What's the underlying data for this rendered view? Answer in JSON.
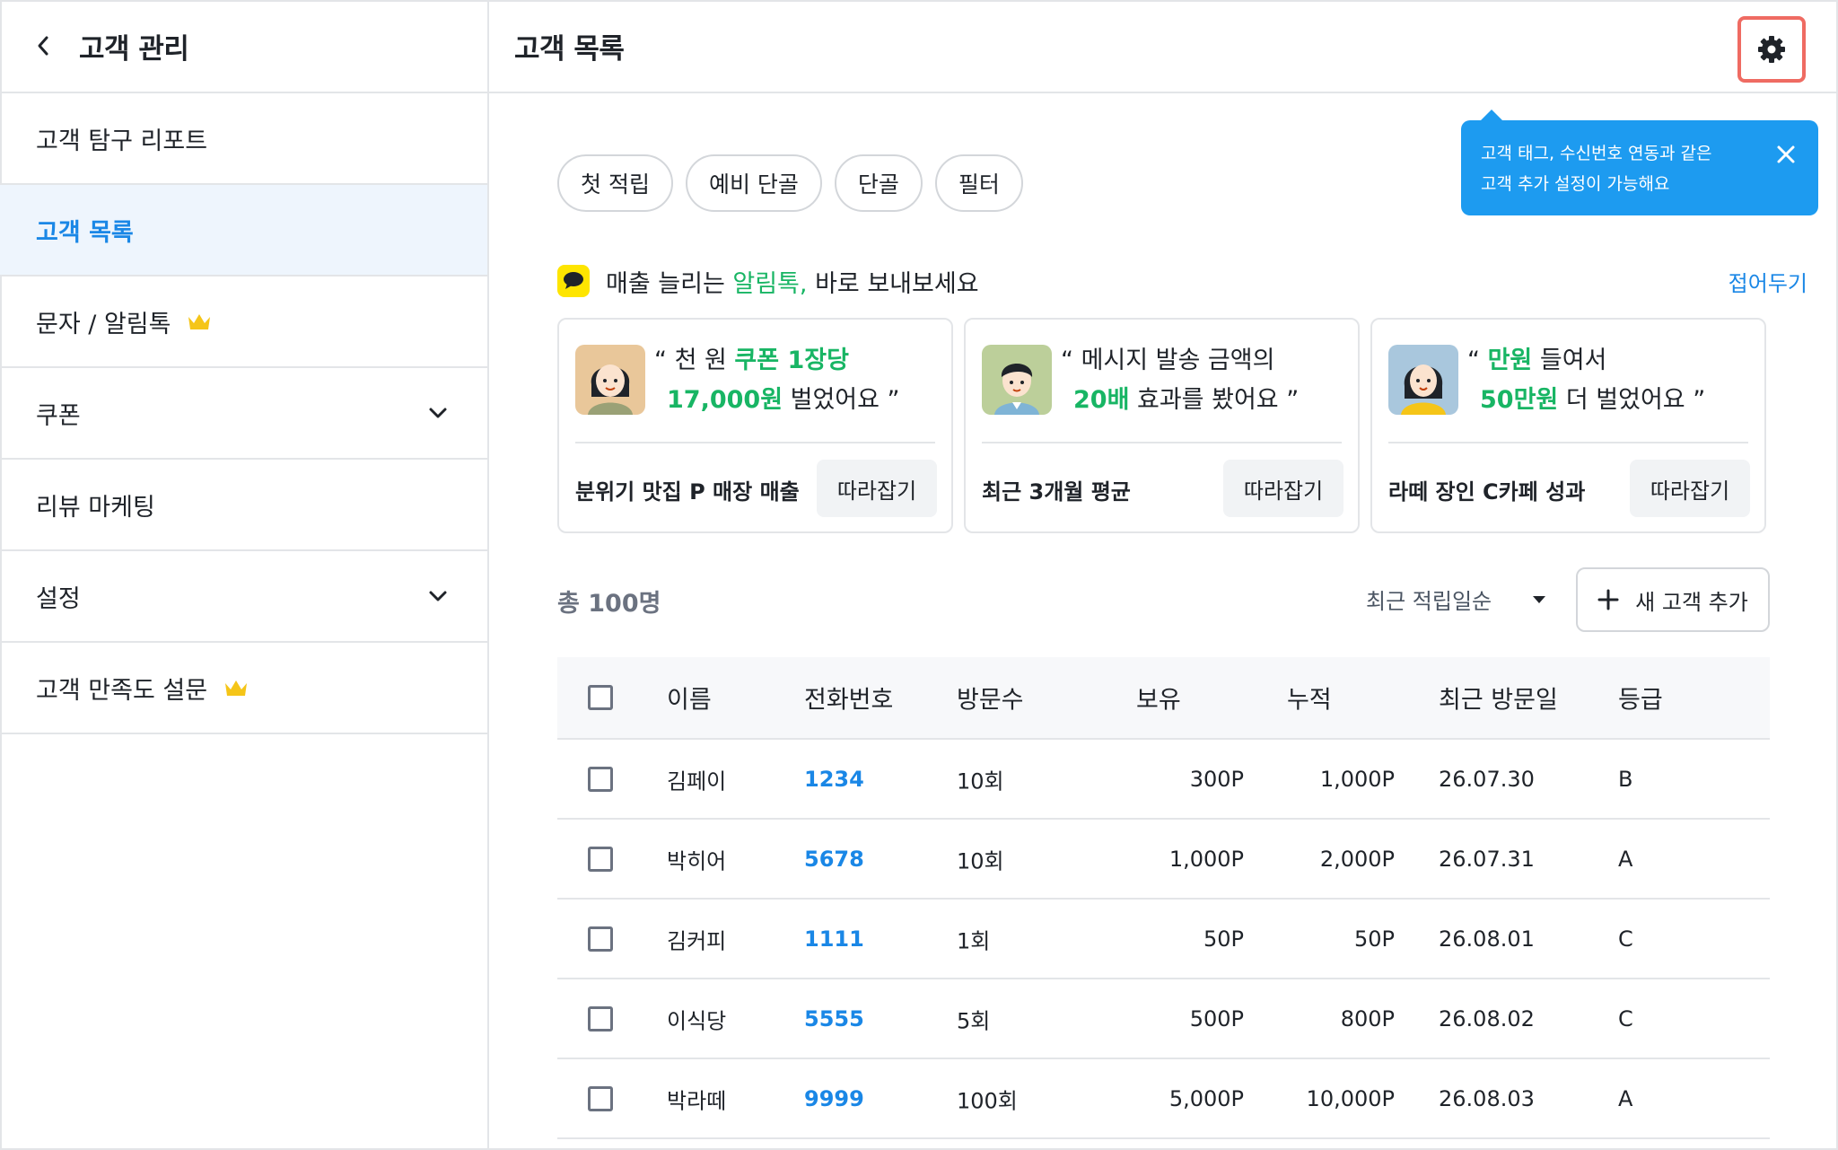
{
  "sidebar": {
    "title": "고객 관리",
    "items": [
      {
        "label": "고객 탐구 리포트"
      },
      {
        "label": "고객 목록"
      },
      {
        "label": "문자 / 알림톡"
      },
      {
        "label": "쿠폰"
      },
      {
        "label": "리뷰 마케팅"
      },
      {
        "label": "설정"
      },
      {
        "label": "고객 만족도 설문"
      }
    ]
  },
  "header": {
    "title": "고객 목록"
  },
  "tooltip": {
    "line1": "고객 태그, 수신번호 연동과 같은",
    "line2": "고객 추가 설정이 가능해요"
  },
  "chips": [
    "첫 적립",
    "예비 단골",
    "단골",
    "필터"
  ],
  "promo": {
    "text_before": "매출 늘리는 ",
    "highlight": "알림톡,",
    "text_after": " 바로 보내보세요",
    "fold_label": "접어두기"
  },
  "cards": [
    {
      "q1a": "“ 천 원 ",
      "q1b": "쿠폰 1장당",
      "q1c": "",
      "q2a": "17,000원",
      "q2b": " 벌었어요 ”",
      "meta": "분위기 맛집 P 매장 매출",
      "button": "따라잡기"
    },
    {
      "q1a": "“ 메시지 발송 금액의",
      "q1b": "",
      "q1c": "",
      "q2a": "20배",
      "q2b": " 효과를 봤어요  ”",
      "meta": "최근 3개월 평균",
      "button": "따라잡기"
    },
    {
      "q1a": "“ ",
      "q1b": "만원",
      "q1c": " 들여서",
      "q2a": "50만원",
      "q2b": " 더 벌었어요 ”",
      "meta": "라떼 장인 C카페 성과",
      "button": "따라잡기"
    }
  ],
  "list": {
    "total": "총 100명",
    "sort": "최근 적립일순",
    "add_label": "새 고객 추가"
  },
  "table": {
    "headers": {
      "name": "이름",
      "phone": "전화번호",
      "visits": "방문수",
      "hold": "보유",
      "acc": "누적",
      "last": "최근 방문일",
      "grade": "등급"
    },
    "rows": [
      {
        "name": "김페이",
        "phone": "1234",
        "visits": "10회",
        "hold": "300P",
        "acc": "1,000P",
        "last": "26.07.30",
        "grade": "B"
      },
      {
        "name": "박히어",
        "phone": "5678",
        "visits": "10회",
        "hold": "1,000P",
        "acc": "2,000P",
        "last": "26.07.31",
        "grade": "A"
      },
      {
        "name": "김커피",
        "phone": "1111",
        "visits": "1회",
        "hold": "50P",
        "acc": "50P",
        "last": "26.08.01",
        "grade": "C"
      },
      {
        "name": "이식당",
        "phone": "5555",
        "visits": "5회",
        "hold": "500P",
        "acc": "800P",
        "last": "26.08.02",
        "grade": "C"
      },
      {
        "name": "박라떼",
        "phone": "9999",
        "visits": "100회",
        "hold": "5,000P",
        "acc": "10,000P",
        "last": "26.08.03",
        "grade": "A"
      }
    ]
  },
  "colors": {
    "accent": "#1a87e6",
    "green": "#18b564",
    "tooltip": "#1d9bf0",
    "highlight_border": "#ef6b62",
    "crown": "#f5c518"
  }
}
